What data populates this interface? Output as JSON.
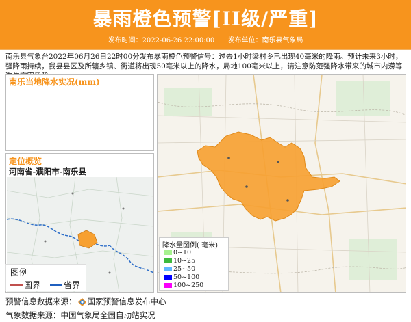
{
  "header": {
    "title": "暴雨橙色预警[II级/严重]",
    "publish_time": "发布时间：2022-06-26 22:00:00",
    "publisher": "发布单位：南乐县气象局"
  },
  "description": "南乐县气象台2022年06月26日22时00分发布暴雨橙色预警信号：过去1小时梁村乡已出现40毫米的降雨。预计未来3小时，强降雨持续，我县县区及所辖乡镇、街道将出现50毫米以上的降水，局地100毫米以上，请注意防范强降水带来的城市内涝等次生灾害风险。",
  "rain_panel": {
    "title": "南乐当地降水实况(mm)"
  },
  "location_panel": {
    "title": "定位概览",
    "region": "河南省-濮阳市-南乐县"
  },
  "mini_legend": {
    "title": "图例",
    "national": "国界",
    "provincial": "省界",
    "national_color": "#c0504d",
    "provincial_color": "#1f5fbf"
  },
  "rain_legend": {
    "title": "降水量图例( 毫米)",
    "items": [
      {
        "label": "0~10",
        "color": "#a6f28f"
      },
      {
        "label": "10~25",
        "color": "#3dba3d"
      },
      {
        "label": "25~50",
        "color": "#61b8ff"
      },
      {
        "label": "50~100",
        "color": "#0000fe"
      },
      {
        "label": "100~250",
        "color": "#fa00fa"
      }
    ]
  },
  "footer": {
    "source1_prefix": "预警信息数据来源：",
    "source1_name": "国家预警信息发布中心",
    "source2": "气象数据来源：中国气象局全国自动站实况"
  },
  "colors": {
    "accent": "#f7941d",
    "warning_area": "#f7a030"
  }
}
